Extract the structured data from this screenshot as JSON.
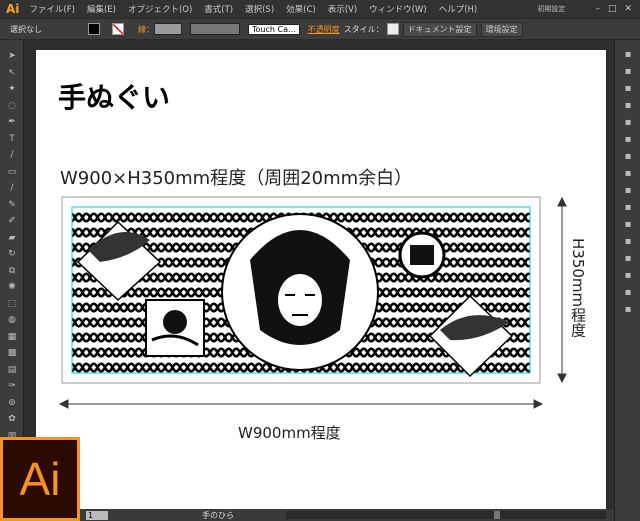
{
  "app": {
    "logo": "Ai",
    "workspace": "初期設定"
  },
  "menu": [
    "ファイル(F)",
    "編集(E)",
    "オブジェクト(O)",
    "書式(T)",
    "選択(S)",
    "効果(C)",
    "表示(V)",
    "ウィンドウ(W)",
    "ヘルプ(H)"
  ],
  "control": {
    "selection": "選択なし",
    "stroke_label": "線：",
    "brush": "Touch Ca...",
    "opacity": "不透明度",
    "style": "スタイル：",
    "doc_settings": "ドキュメント設定",
    "prefs": "環境設定"
  },
  "document": {
    "title": "手ぬぐい",
    "dimension": "W900×H350mm程度（周囲20mm余白）",
    "width_label": "W900mm程度",
    "height_label": "H350mm程度"
  },
  "bottom": {
    "artboard": "1",
    "tool": "手のひら"
  },
  "colors": {
    "accent": "#f7931e",
    "guide": "#00d0e0"
  }
}
